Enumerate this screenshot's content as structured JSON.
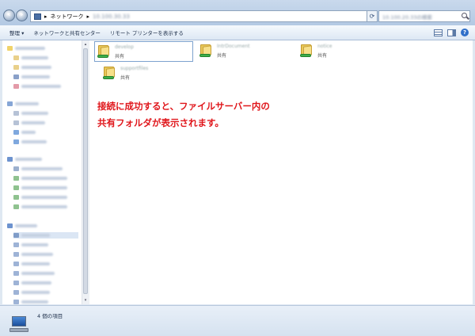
{
  "address": {
    "crumb_network": "ネットワーク",
    "crumb_host": "10.100.30.33",
    "separator": "▸"
  },
  "search": {
    "placeholder": "10.100.20.33の検索"
  },
  "toolbar": {
    "organize_label": "整理 ▾",
    "network_center_label": "ネットワークと共有センター",
    "printers_label": "リモート プリンターを表示する"
  },
  "shares": [
    {
      "name": "develop",
      "type": "共有"
    },
    {
      "name": "IntrDocument",
      "type": "共有"
    },
    {
      "name": "notice",
      "type": "共有"
    },
    {
      "name": "supportfiles",
      "type": "共有"
    }
  ],
  "annotation": {
    "line1": "接続に成功すると、ファイルサーバー内の",
    "line2": "共有フォルダが表示されます。"
  },
  "status": {
    "item_count": "4 個の項目"
  },
  "colors": {
    "annotation_red": "#e0161b",
    "window_chrome": "#dfe8f2"
  }
}
